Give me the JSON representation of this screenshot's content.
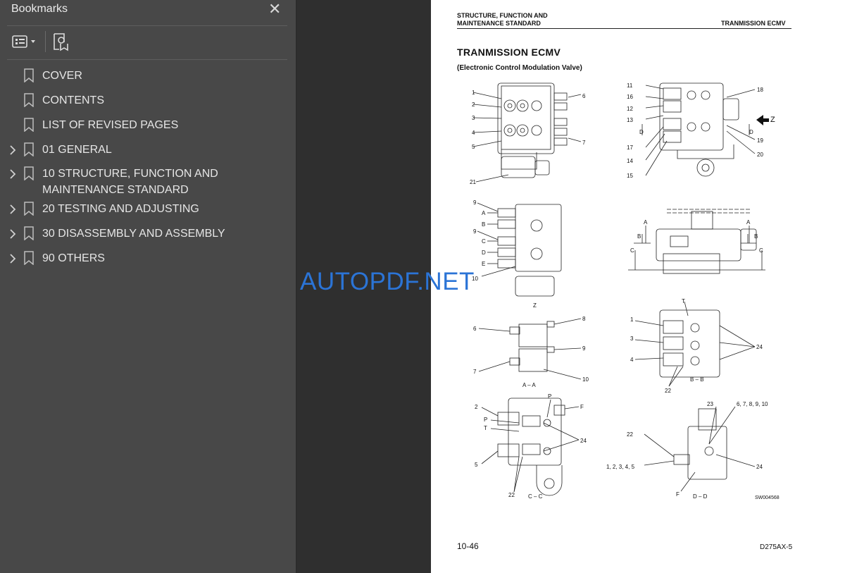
{
  "panel": {
    "title": "Bookmarks",
    "close_glyph": "✕",
    "toolbar": [
      {
        "name": "options-menu",
        "icon": "list-options-icon"
      },
      {
        "name": "find-bookmark",
        "icon": "search-bookmark-icon"
      }
    ],
    "items": [
      {
        "label": "COVER",
        "expandable": false
      },
      {
        "label": "CONTENTS",
        "expandable": false
      },
      {
        "label": "LIST OF REVISED PAGES",
        "expandable": false
      },
      {
        "label": "01 GENERAL",
        "expandable": true
      },
      {
        "label": "10 STRUCTURE, FUNCTION AND MAINTENANCE STANDARD",
        "expandable": true
      },
      {
        "label": "20 TESTING AND ADJUSTING",
        "expandable": true
      },
      {
        "label": "30 DISASSEMBLY AND ASSEMBLY",
        "expandable": true
      },
      {
        "label": "90 OTHERS",
        "expandable": true
      }
    ]
  },
  "page": {
    "header_left_1": "STRUCTURE, FUNCTION AND",
    "header_left_2": "MAINTENANCE STANDARD",
    "header_right": "TRANMISSION ECMV",
    "title": "TRANMISSION ECMV",
    "subtitle": "(Electronic Control Modulation Valve)",
    "figure_id": "SW004568",
    "page_number": "10-46",
    "model": "D275AX-5",
    "labels": {
      "z_arrow": "Z",
      "z_view": "Z",
      "aa": "A – A",
      "bb": "B – B",
      "cc": "C – C",
      "dd": "D – D",
      "n6789": "6, 7, 8, 9, 10",
      "n12345": "1, 2, 3, 4, 5"
    }
  },
  "watermark": "AUTOPDF.NET"
}
